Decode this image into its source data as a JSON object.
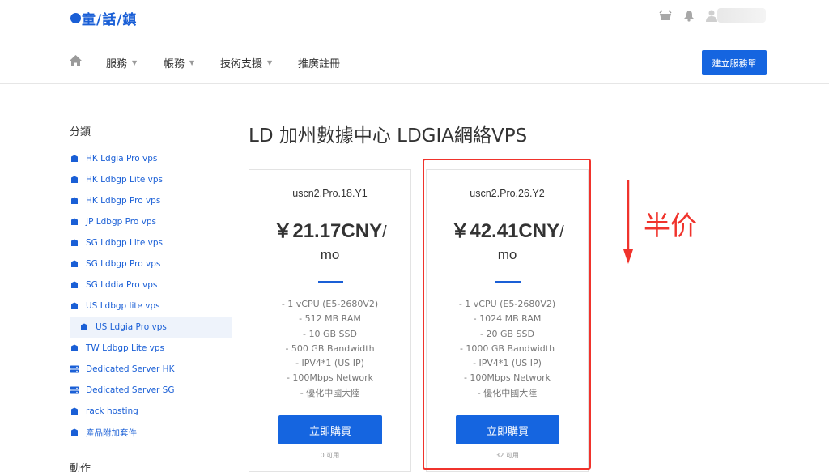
{
  "brand": {
    "logo_text": "童/話/鎮",
    "color": "#1a5fd6"
  },
  "header_icons": [
    "basket-icon",
    "bell-icon",
    "user-icon"
  ],
  "nav": {
    "items": [
      {
        "label": "服務",
        "has_caret": true
      },
      {
        "label": "帳務",
        "has_caret": true
      },
      {
        "label": "技術支援",
        "has_caret": true
      },
      {
        "label": "推廣註冊",
        "has_caret": false
      }
    ],
    "cta": "建立服務單"
  },
  "sidebar": {
    "title": "分類",
    "items": [
      {
        "label": "HK Ldgia Pro vps",
        "icon": "box-icon"
      },
      {
        "label": "HK Ldbgp Lite vps",
        "icon": "box-icon"
      },
      {
        "label": "HK Ldbgp Pro vps",
        "icon": "box-icon"
      },
      {
        "label": "JP Ldbgp Pro vps",
        "icon": "box-icon"
      },
      {
        "label": "SG Ldbgp Lite vps",
        "icon": "box-icon"
      },
      {
        "label": "SG Ldbgp Pro vps",
        "icon": "box-icon"
      },
      {
        "label": "SG Lddia Pro vps",
        "icon": "box-icon"
      },
      {
        "label": "US Ldbgp lite vps",
        "icon": "box-icon"
      },
      {
        "label": "US Ldgia Pro vps",
        "icon": "box-icon",
        "active": true
      },
      {
        "label": "TW Ldbgp Lite vps",
        "icon": "box-icon"
      },
      {
        "label": "Dedicated Server HK",
        "icon": "server-icon"
      },
      {
        "label": "Dedicated Server SG",
        "icon": "server-icon"
      },
      {
        "label": "rack hosting",
        "icon": "box-icon"
      },
      {
        "label": "產品附加套件",
        "icon": "box-icon"
      }
    ],
    "section2_title": "動作"
  },
  "page_title": "LD 加州數據中心 LDGIA網絡VPS",
  "products": [
    {
      "name": "uscn2.Pro.18.Y1",
      "price": "￥21.17CNY",
      "slash": "/",
      "period": "mo",
      "features": [
        "- 1 vCPU (E5-2680V2)",
        "- 512 MB RAM",
        "- 10 GB SSD",
        "- 500 GB Bandwidth",
        "- IPV4*1 (US IP)",
        "- 100Mbps Network",
        "- 優化中國大陸"
      ],
      "buy_label": "立即購買",
      "availability": "0 可用"
    },
    {
      "name": "uscn2.Pro.26.Y2",
      "price": "￥42.41CNY",
      "slash": "/",
      "period": "mo",
      "features": [
        "- 1 vCPU (E5-2680V2)",
        "- 1024 MB RAM",
        "- 20 GB SSD",
        "- 1000 GB Bandwidth",
        "- IPV4*1 (US IP)",
        "- 100Mbps Network",
        "- 優化中國大陸"
      ],
      "buy_label": "立即購買",
      "availability": "32 可用"
    }
  ],
  "annotation": {
    "text": "半价",
    "color": "#f0332c"
  },
  "colors": {
    "primary": "#1565e0",
    "link": "#1a5fd6",
    "annotation": "#f0332c"
  }
}
